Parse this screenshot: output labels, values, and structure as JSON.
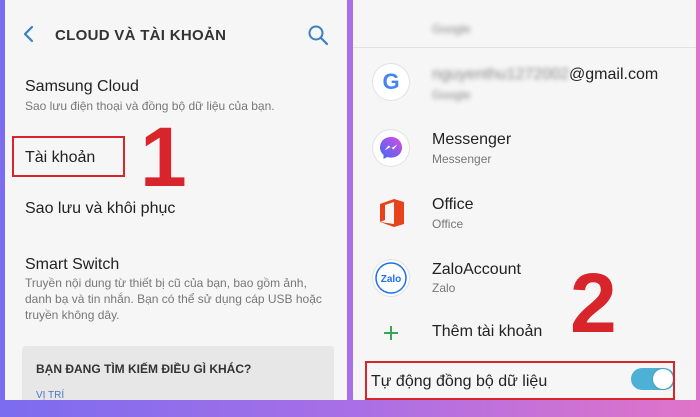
{
  "left": {
    "title": "CLOUD VÀ TÀI KHOẢN",
    "items": [
      {
        "title": "Samsung Cloud",
        "subtitle": "Sao lưu điện thoại và đồng bộ dữ liệu của bạn."
      },
      {
        "title": "Tài khoản"
      },
      {
        "title": "Sao lưu và khôi phục"
      },
      {
        "title": "Smart Switch",
        "subtitle": "Truyền nội dung từ thiết bị cũ của bạn, bao gồm ảnh, danh bạ và tin nhắn. Bạn có thể sử dụng cáp USB hoặc truyền không dây."
      }
    ],
    "find_box": {
      "heading": "BẠN ĐANG TÌM KIẾM ĐIỀU GÌ KHÁC?",
      "link": "VỊ TRÍ"
    },
    "step_number": "1"
  },
  "right": {
    "accounts": [
      {
        "title": "",
        "subtitle": "Google",
        "icon": "google-icon"
      },
      {
        "title": "nguyenthu1272002@gmail.com",
        "subtitle": "Google",
        "icon": "google-icon"
      },
      {
        "title": "Messenger",
        "subtitle": "Messenger",
        "icon": "messenger-icon"
      },
      {
        "title": "Office",
        "subtitle": "Office",
        "icon": "office-icon"
      },
      {
        "title": "ZaloAccount",
        "subtitle": "Zalo",
        "icon": "zalo-icon"
      }
    ],
    "add_account": "Thêm tài khoản",
    "auto_sync": {
      "label": "Tự động đồng bộ dữ liệu",
      "enabled": true
    },
    "step_number": "2"
  },
  "colors": {
    "accent_red": "#d8242b",
    "toggle_on": "#4db1d6"
  }
}
